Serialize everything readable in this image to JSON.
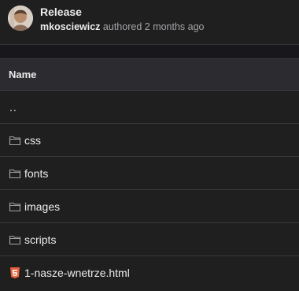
{
  "commit": {
    "title": "Release",
    "author": "mkosciewicz",
    "action": "authored",
    "time": "2 months ago"
  },
  "table": {
    "header": "Name",
    "parent": "..",
    "rows": [
      {
        "name": "css",
        "icon": "folder-icon"
      },
      {
        "name": "fonts",
        "icon": "folder-icon"
      },
      {
        "name": "images",
        "icon": "folder-icon"
      },
      {
        "name": "scripts",
        "icon": "folder-icon"
      },
      {
        "name": "1-nasze-wnetrze.html",
        "icon": "html5-icon"
      }
    ]
  },
  "colors": {
    "background": "#1f1f1f",
    "header_bg": "#2b2b30",
    "html_icon": "#e8613a"
  }
}
